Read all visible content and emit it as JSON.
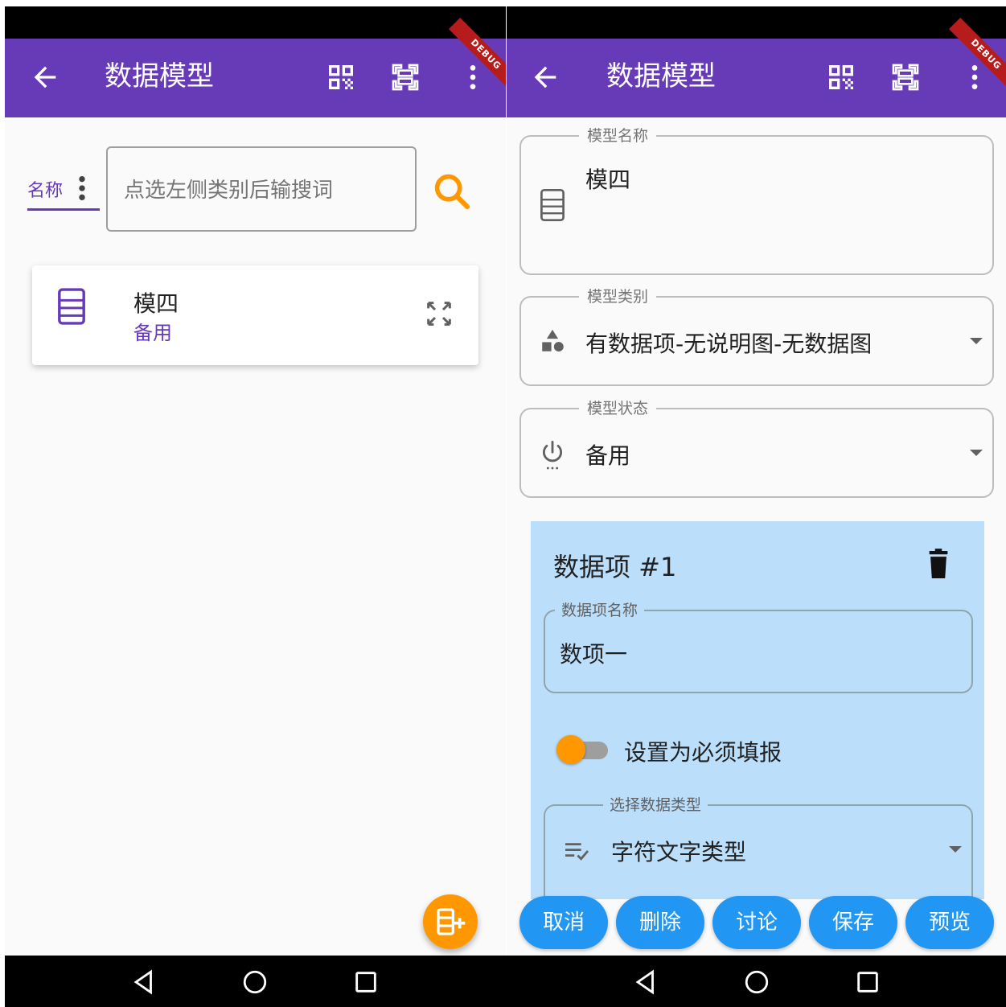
{
  "app": {
    "title": "数据模型",
    "debug_banner": "DEBUG"
  },
  "left": {
    "filter_tab": "名称",
    "search": {
      "placeholder": "点选左侧类别后输搜词",
      "value": ""
    },
    "list": [
      {
        "name": "模四",
        "status": "备用"
      }
    ]
  },
  "right": {
    "model_name": {
      "label": "模型名称",
      "value": "模四"
    },
    "model_category": {
      "label": "模型类别",
      "value": "有数据项-无说明图-无数据图"
    },
    "model_state": {
      "label": "模型状态",
      "value": "备用"
    },
    "data_item": {
      "title": "数据项 #1",
      "name_label": "数据项名称",
      "name_value": "数项一",
      "required_label": "设置为必须填报",
      "required_on": false,
      "type_label": "选择数据类型",
      "type_value": "字符文字类型"
    },
    "actions": [
      "取消",
      "删除",
      "讨论",
      "保存",
      "预览"
    ]
  },
  "colors": {
    "primary": "#673ab7",
    "accent": "#ff9800",
    "action": "#2196f3",
    "item_bg": "#bbdefb"
  },
  "icons": {
    "back": "arrow-left-icon",
    "qr": "qr-code-icon",
    "scan": "scan-icon",
    "more": "more-vert-icon",
    "search": "search-icon",
    "document": "document-icon",
    "expand": "expand-icon",
    "category": "shapes-icon",
    "power": "power-icon",
    "trash": "trash-icon",
    "text_type": "text-format-icon",
    "add_item": "add-item-icon"
  }
}
